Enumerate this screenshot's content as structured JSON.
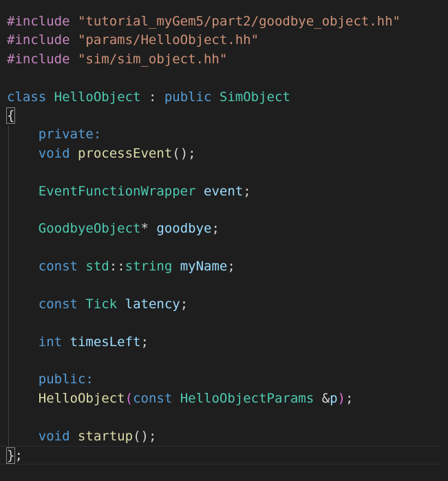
{
  "editor": {
    "lines": [
      {
        "tokens": [
          {
            "t": "#include",
            "c": "pp"
          },
          {
            "t": " ",
            "c": "punc"
          },
          {
            "t": "\"tutorial_myGem5/part2/goodbye_object.hh\"",
            "c": "str"
          }
        ]
      },
      {
        "tokens": [
          {
            "t": "#include",
            "c": "pp"
          },
          {
            "t": " ",
            "c": "punc"
          },
          {
            "t": "\"params/HelloObject.hh\"",
            "c": "str"
          }
        ]
      },
      {
        "tokens": [
          {
            "t": "#include",
            "c": "pp"
          },
          {
            "t": " ",
            "c": "punc"
          },
          {
            "t": "\"sim/sim_object.hh\"",
            "c": "str"
          }
        ]
      },
      {
        "tokens": []
      },
      {
        "tokens": [
          {
            "t": "class",
            "c": "kw"
          },
          {
            "t": " ",
            "c": "punc"
          },
          {
            "t": "HelloObject",
            "c": "type"
          },
          {
            "t": " : ",
            "c": "punc"
          },
          {
            "t": "public",
            "c": "kw"
          },
          {
            "t": " ",
            "c": "punc"
          },
          {
            "t": "SimObject",
            "c": "type"
          }
        ]
      },
      {
        "tokens": [
          {
            "t": "{",
            "c": "punc",
            "box": true
          }
        ]
      },
      {
        "tokens": [
          {
            "t": "    ",
            "c": "punc"
          },
          {
            "t": "private:",
            "c": "kw"
          }
        ]
      },
      {
        "tokens": [
          {
            "t": "    ",
            "c": "punc"
          },
          {
            "t": "void",
            "c": "kw"
          },
          {
            "t": " ",
            "c": "punc"
          },
          {
            "t": "processEvent",
            "c": "fn"
          },
          {
            "t": "();",
            "c": "punc"
          }
        ]
      },
      {
        "tokens": []
      },
      {
        "tokens": [
          {
            "t": "    ",
            "c": "punc"
          },
          {
            "t": "EventFunctionWrapper",
            "c": "type"
          },
          {
            "t": " ",
            "c": "punc"
          },
          {
            "t": "event",
            "c": "var"
          },
          {
            "t": ";",
            "c": "punc"
          }
        ]
      },
      {
        "tokens": []
      },
      {
        "tokens": [
          {
            "t": "    ",
            "c": "punc"
          },
          {
            "t": "GoodbyeObject",
            "c": "type"
          },
          {
            "t": "* ",
            "c": "punc"
          },
          {
            "t": "goodbye",
            "c": "var"
          },
          {
            "t": ";",
            "c": "punc"
          }
        ]
      },
      {
        "tokens": []
      },
      {
        "tokens": [
          {
            "t": "    ",
            "c": "punc"
          },
          {
            "t": "const",
            "c": "kw"
          },
          {
            "t": " ",
            "c": "punc"
          },
          {
            "t": "std",
            "c": "type"
          },
          {
            "t": "::",
            "c": "punc"
          },
          {
            "t": "string",
            "c": "type"
          },
          {
            "t": " ",
            "c": "punc"
          },
          {
            "t": "myName",
            "c": "var"
          },
          {
            "t": ";",
            "c": "punc"
          }
        ]
      },
      {
        "tokens": []
      },
      {
        "tokens": [
          {
            "t": "    ",
            "c": "punc"
          },
          {
            "t": "const",
            "c": "kw"
          },
          {
            "t": " ",
            "c": "punc"
          },
          {
            "t": "Tick",
            "c": "type"
          },
          {
            "t": " ",
            "c": "punc"
          },
          {
            "t": "latency",
            "c": "var"
          },
          {
            "t": ";",
            "c": "punc"
          }
        ]
      },
      {
        "tokens": []
      },
      {
        "tokens": [
          {
            "t": "    ",
            "c": "punc"
          },
          {
            "t": "int",
            "c": "kw"
          },
          {
            "t": " ",
            "c": "punc"
          },
          {
            "t": "timesLeft",
            "c": "var"
          },
          {
            "t": ";",
            "c": "punc"
          }
        ]
      },
      {
        "tokens": []
      },
      {
        "tokens": [
          {
            "t": "    ",
            "c": "punc"
          },
          {
            "t": "public:",
            "c": "kw"
          }
        ]
      },
      {
        "tokens": [
          {
            "t": "    ",
            "c": "punc"
          },
          {
            "t": "HelloObject",
            "c": "fn"
          },
          {
            "t": "(",
            "c": "br2"
          },
          {
            "t": "const",
            "c": "kw"
          },
          {
            "t": " ",
            "c": "punc"
          },
          {
            "t": "HelloObjectParams",
            "c": "type"
          },
          {
            "t": " &",
            "c": "punc"
          },
          {
            "t": "p",
            "c": "var"
          },
          {
            "t": ")",
            "c": "br2"
          },
          {
            "t": ";",
            "c": "punc"
          }
        ]
      },
      {
        "tokens": []
      },
      {
        "tokens": [
          {
            "t": "    ",
            "c": "punc"
          },
          {
            "t": "void",
            "c": "kw"
          },
          {
            "t": " ",
            "c": "punc"
          },
          {
            "t": "startup",
            "c": "fn"
          },
          {
            "t": "();",
            "c": "punc"
          }
        ]
      },
      {
        "tokens": [
          {
            "t": "}",
            "c": "punc",
            "box": true
          },
          {
            "t": ";",
            "c": "punc"
          }
        ],
        "current": true
      }
    ]
  },
  "colors": {
    "background": "#1e1e1e",
    "preprocessor": "#c586c0",
    "string": "#ce9178",
    "keyword": "#569cd6",
    "type": "#4ec9b0",
    "function": "#dcdcaa",
    "variable": "#9cdcfe",
    "punctuation": "#d4d4d4"
  }
}
